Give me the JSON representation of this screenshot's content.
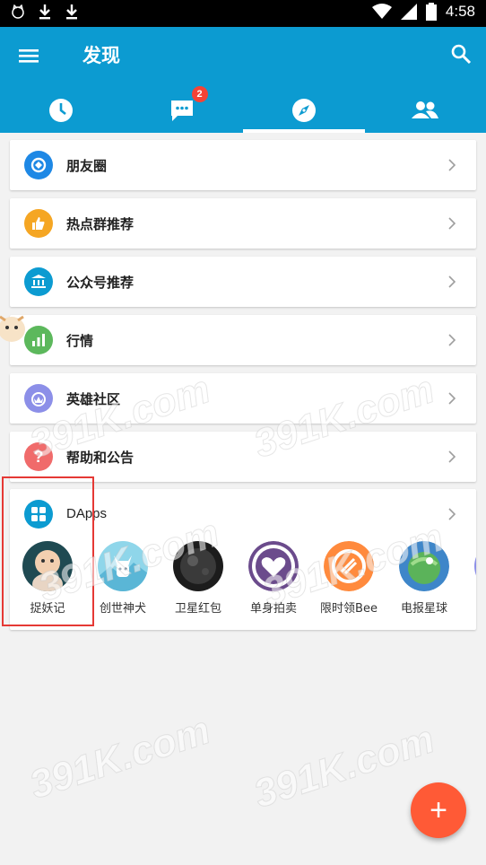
{
  "status_bar": {
    "time": "4:58"
  },
  "app_bar": {
    "title": "发现",
    "tabs": [
      {
        "icon": "clock-icon"
      },
      {
        "icon": "chat-icon",
        "badge": "2"
      },
      {
        "icon": "compass-icon",
        "active": true
      },
      {
        "icon": "contacts-icon"
      }
    ]
  },
  "list": {
    "items": [
      {
        "label": "朋友圈",
        "icon": "moments-icon",
        "color": "#1e88e5"
      },
      {
        "label": "热点群推荐",
        "icon": "thumbs-up-icon",
        "color": "#f5a623"
      },
      {
        "label": "公众号推荐",
        "icon": "bank-icon",
        "color": "#0c9bd1"
      },
      {
        "label": "行情",
        "icon": "bar-chart-icon",
        "color": "#5cb85c"
      },
      {
        "label": "英雄社区",
        "icon": "crown-icon",
        "color": "#8c8fe8"
      },
      {
        "label": "帮助和公告",
        "icon": "question-icon",
        "color": "#f06b6b"
      }
    ]
  },
  "dapps": {
    "label": "DApps",
    "icon_color": "#0c9bd1",
    "apps": [
      {
        "name": "捉妖记",
        "color": "#b7d6d4"
      },
      {
        "name": "创世神犬",
        "color": "#6cc4e0"
      },
      {
        "name": "卫星红包",
        "color": "#3a3a3a"
      },
      {
        "name": "单身拍卖",
        "color": "#6b4b8c"
      },
      {
        "name": "限时领Bee",
        "color": "#ff8a3d"
      },
      {
        "name": "电报星球",
        "color": "#3e86c9"
      }
    ]
  },
  "watermark": "391K.com",
  "fab": {
    "label": "+",
    "color": "#ff5a36"
  }
}
